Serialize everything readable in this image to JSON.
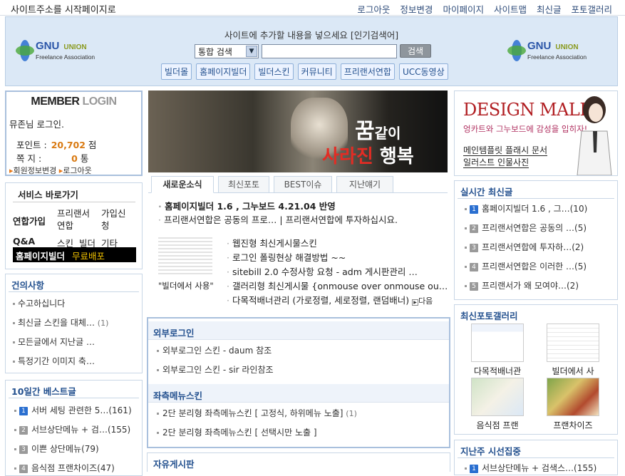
{
  "topbar": {
    "home_link": "사이트주소를 시작페이지로",
    "links": [
      "로그아웃",
      "정보변경",
      "마이페이지",
      "사이트맵",
      "최신글",
      "포토갤러리"
    ]
  },
  "header": {
    "logo_main": "GNU",
    "logo_union": "UNION",
    "logo_sub": "Freelance  Association",
    "hint": "사이트에 추가할 내용을 넣으세요 [인기검색어]",
    "search_select": "통합 검색",
    "search_button": "검색",
    "quick_buttons": [
      "빌더몰",
      "홈페이지빌더",
      "빌더스킨",
      "커뮤니티",
      "프리랜서연합",
      "UCC동영상"
    ]
  },
  "login": {
    "title_member": "MEMBER",
    "title_login": "LOGIN",
    "user": "뮤존님 로그인.",
    "point_label": "포인트 :",
    "point_value": "20,702",
    "point_unit": "점",
    "note_label": "쪽    지 :",
    "note_value": "0",
    "note_unit": "통",
    "edit_link": "회원정보변경",
    "logout_link": "로그아웃"
  },
  "service": {
    "title": "서비스 바로가기",
    "row1_head": "연합가입",
    "row1_a": "프리랜서",
    "row1_a2": "연합",
    "row1_b": "가입신",
    "row1_b2": "청",
    "row2_head": "Q&A",
    "row2_a": "스킨",
    "row2_b": "빌더",
    "row2_c": "기타",
    "highlight": "홈페이지빌더",
    "highlight_sub": "무료배포"
  },
  "suggest": {
    "title": "건의사항",
    "items": [
      {
        "text": "수고하십니다",
        "count": ""
      },
      {
        "text": "최신글 스킨을 대체…",
        "count": "(1)"
      },
      {
        "text": "모든글에서 지난글 …",
        "count": ""
      },
      {
        "text": "특정기간 이미지 축…",
        "count": ""
      }
    ]
  },
  "best10": {
    "title": "10일간 베스트글",
    "items": [
      {
        "n": "1",
        "text": "서버 세팅 관련한 5…",
        "count": "(161)"
      },
      {
        "n": "2",
        "text": "서브상단메뉴 + 검…",
        "count": "(155)"
      },
      {
        "n": "3",
        "text": "이쁜 상단메뉴",
        "count": "(79)"
      },
      {
        "n": "4",
        "text": "음식점 프랜차이즈",
        "count": "(47)"
      }
    ],
    "num_colors": [
      "#2a6fd0",
      "#9a9a9a",
      "#9a9a9a",
      "#9a9a9a"
    ]
  },
  "banner": {
    "line1_big": "꿈",
    "line1_small": "같이",
    "line2_red": "사라진",
    "line2_white": "행복"
  },
  "tabs": [
    "새로운소식",
    "최신포토",
    "BEST이슈",
    "지난얘기"
  ],
  "news": {
    "headline": "홈페이지빌더 1.6 , 그누보드 4.21.04 반영",
    "sub": "프리랜서연합은 공동의 프로… | 프리랜서연합에 투자하십시요.",
    "thumb_caption": "\"빌더에서 사용\"",
    "list": [
      "웹진형 최신게시물스킨",
      "로그인 폴링현상 해결방법 ~~",
      "sitebill 2.0 수정사항 요청 - adm 게시판관리 …",
      "갤러리형 최신게시물 {onmouse over onmouse ou…",
      "다목적배너관리 (가로정렬, 세로정렬, 랜덤배너)"
    ],
    "more": "다음"
  },
  "outlogin": {
    "title": "외부로그인",
    "items": [
      "외부로그인 스킨 - daum 참조",
      "외부로그인 스킨 - sir 라인참조"
    ]
  },
  "leftmenu": {
    "title": "좌측메뉴스킨",
    "items": [
      {
        "text": "2단 분리형 좌측메뉴스킨 [ 고정식, 하위메뉴 노출]",
        "count": "(1)"
      },
      {
        "text": "2단 분리형 좌측메뉴스킨 [ 선택시만 노출 ]",
        "count": ""
      }
    ]
  },
  "free": {
    "title": "자유게시판"
  },
  "ad": {
    "title": "DESIGN MALL",
    "tagline": "엉카트와 그누보드에 감성을 입히자!",
    "line1": "메인템플릿 플래시 문서",
    "line2": "일러스트 인물사진"
  },
  "realtime": {
    "title": "실시간 최신글",
    "items": [
      {
        "n": "1",
        "text": "홈페이지빌더 1.6 , 그…",
        "count": "(10)"
      },
      {
        "n": "2",
        "text": "프리랜서연합은 공동의 …",
        "count": "(5)"
      },
      {
        "n": "3",
        "text": "프리랜서연합에 투자하…",
        "count": "(2)"
      },
      {
        "n": "4",
        "text": "프리랜서연합은 이러한 …",
        "count": "(5)"
      },
      {
        "n": "5",
        "text": "프리랜서가 왜 모여야…",
        "count": "(2)"
      }
    ],
    "num_colors": [
      "#2a6fd0",
      "#9a9a9a",
      "#9a9a9a",
      "#9a9a9a",
      "#9a9a9a"
    ]
  },
  "photo": {
    "title": "최신포토갤러리",
    "items": [
      "다목적배너관",
      "빌더에서 사",
      "음식점 프랜",
      "프랜차이즈"
    ]
  },
  "lastweek": {
    "title": "지난주 시선집중",
    "items": [
      {
        "n": "1",
        "text": "서브상단메뉴 + 검색스…",
        "count": "(155)"
      }
    ]
  }
}
